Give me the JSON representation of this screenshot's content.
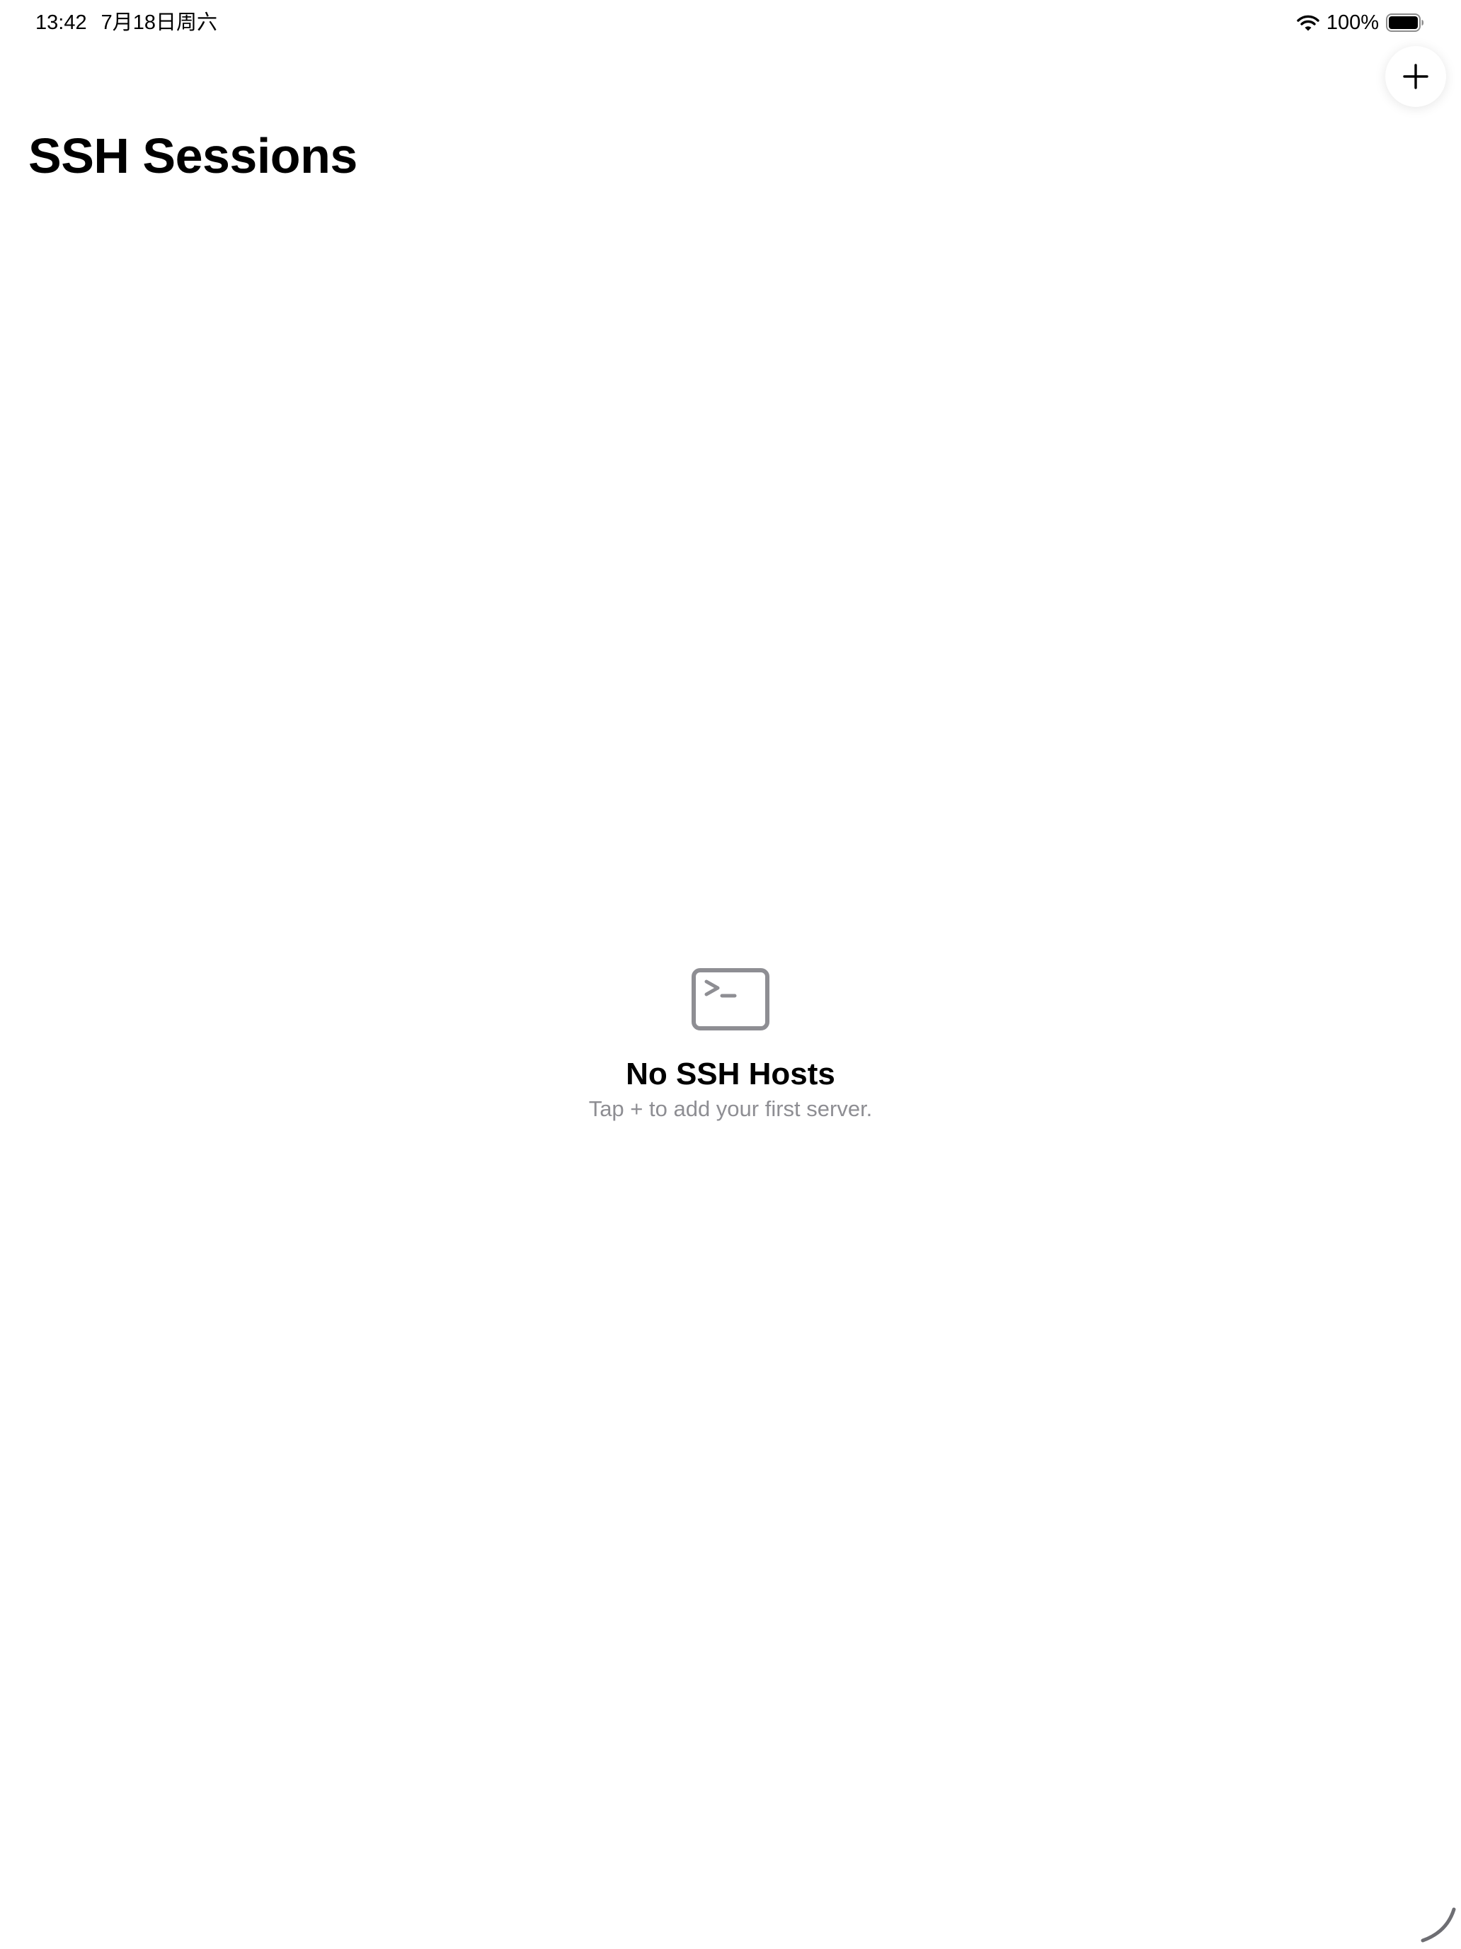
{
  "status_bar": {
    "time": "13:42",
    "date": "7月18日周六",
    "battery_percent": "100%",
    "icons": [
      "wifi-icon",
      "battery-icon"
    ]
  },
  "header": {
    "title": "SSH Sessions",
    "add_button_icon": "plus-icon"
  },
  "empty_state": {
    "icon": "terminal-icon",
    "title": "No SSH Hosts",
    "subtitle": "Tap + to add your first server."
  },
  "colors": {
    "background": "#ffffff",
    "text_primary": "#000000",
    "text_secondary": "#8e8e93",
    "icon_gray": "#8e8e93"
  }
}
